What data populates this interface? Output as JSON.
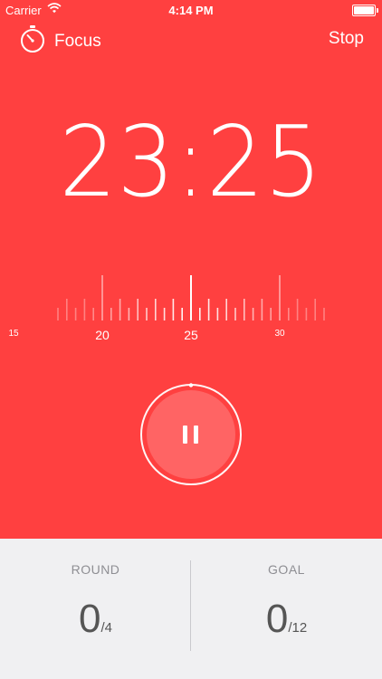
{
  "status_bar": {
    "carrier": "Carrier",
    "time": "4:14 PM"
  },
  "nav": {
    "title": "Focus",
    "stop_label": "Stop"
  },
  "timer": {
    "display": "23:25",
    "ruler_labels": [
      {
        "text": "15",
        "value": 15,
        "size": "small"
      },
      {
        "text": "20",
        "value": 20,
        "size": "large"
      },
      {
        "text": "25",
        "value": 25,
        "size": "large"
      },
      {
        "text": "30",
        "value": 30,
        "size": "small"
      }
    ],
    "progress": 0.02
  },
  "stats": {
    "round": {
      "label": "ROUND",
      "value": "0",
      "total": "/4"
    },
    "goal": {
      "label": "GOAL",
      "value": "0",
      "total": "/12"
    }
  },
  "colors": {
    "accent": "#ff4040",
    "button": "#ff6464",
    "panel": "#f0f0f2"
  }
}
